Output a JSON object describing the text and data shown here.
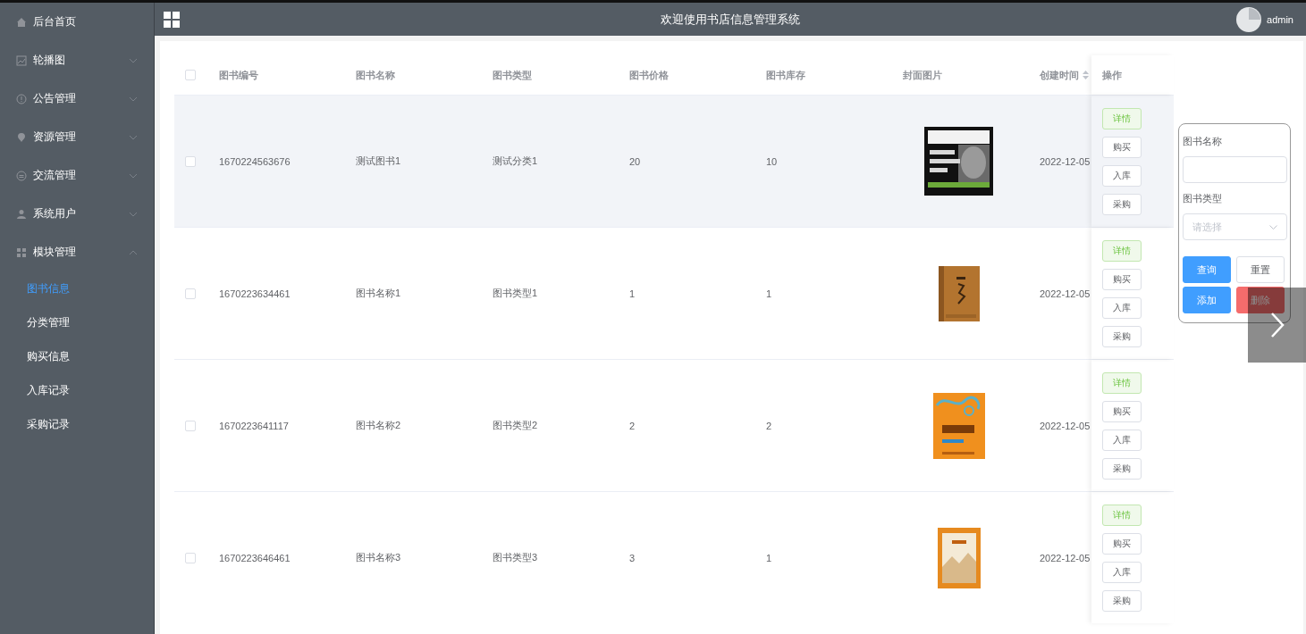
{
  "header": {
    "title": "欢迎使用书店信息管理系统",
    "user": "admin"
  },
  "sidebar": {
    "items": [
      {
        "label": "后台首页",
        "kind": "link"
      },
      {
        "label": "轮播图",
        "kind": "menu",
        "expanded": false
      },
      {
        "label": "公告管理",
        "kind": "menu",
        "expanded": false
      },
      {
        "label": "资源管理",
        "kind": "menu",
        "expanded": false
      },
      {
        "label": "交流管理",
        "kind": "menu",
        "expanded": false
      },
      {
        "label": "系统用户",
        "kind": "menu",
        "expanded": false
      },
      {
        "label": "模块管理",
        "kind": "menu",
        "expanded": true,
        "children": [
          {
            "label": "图书信息",
            "selected": true
          },
          {
            "label": "分类管理",
            "selected": false
          },
          {
            "label": "购买信息",
            "selected": false
          },
          {
            "label": "入库记录",
            "selected": false
          },
          {
            "label": "采购记录",
            "selected": false
          }
        ]
      }
    ]
  },
  "table": {
    "header_checked": false,
    "columns": [
      {
        "label": "图书编号",
        "sortable": false
      },
      {
        "label": "图书名称",
        "sortable": false
      },
      {
        "label": "图书类型",
        "sortable": false
      },
      {
        "label": "图书价格",
        "sortable": false
      },
      {
        "label": "图书库存",
        "sortable": false
      },
      {
        "label": "封面图片",
        "sortable": false
      },
      {
        "label": "创建时间",
        "sortable": true
      }
    ],
    "actions_header": "操作",
    "rows": [
      {
        "checked": false,
        "highlighted": true,
        "cells": [
          "1670224563676",
          "测试图书1",
          "测试分类1",
          "20",
          "10"
        ],
        "created": "2022-12-05",
        "actions": [
          {
            "label": "详情",
            "kind": "success"
          },
          {
            "label": "购买",
            "kind": "plain"
          },
          {
            "label": "入库",
            "kind": "plain"
          },
          {
            "label": "采购",
            "kind": "plain"
          }
        ]
      },
      {
        "checked": false,
        "highlighted": false,
        "cells": [
          "1670223634461",
          "图书名称1",
          "图书类型1",
          "1",
          "1"
        ],
        "created": "2022-12-05",
        "actions": [
          {
            "label": "详情",
            "kind": "success"
          },
          {
            "label": "购买",
            "kind": "plain"
          },
          {
            "label": "入库",
            "kind": "plain"
          },
          {
            "label": "采购",
            "kind": "plain"
          }
        ]
      },
      {
        "checked": false,
        "highlighted": false,
        "cells": [
          "1670223641117",
          "图书名称2",
          "图书类型2",
          "2",
          "2"
        ],
        "created": "2022-12-05",
        "actions": [
          {
            "label": "详情",
            "kind": "success"
          },
          {
            "label": "购买",
            "kind": "plain"
          },
          {
            "label": "入库",
            "kind": "plain"
          },
          {
            "label": "采购",
            "kind": "plain"
          }
        ]
      },
      {
        "checked": false,
        "highlighted": false,
        "cells": [
          "1670223646461",
          "图书名称3",
          "图书类型3",
          "3",
          "1"
        ],
        "created": "2022-12-05",
        "actions": [
          {
            "label": "详情",
            "kind": "success"
          },
          {
            "label": "购买",
            "kind": "plain"
          },
          {
            "label": "入库",
            "kind": "plain"
          },
          {
            "label": "采购",
            "kind": "plain"
          }
        ]
      }
    ]
  },
  "search": {
    "fields": [
      {
        "label": "图书名称",
        "kind": "text"
      },
      {
        "label": "图书类型",
        "kind": "select",
        "placeholder": "请选择"
      }
    ],
    "buttons": [
      {
        "label": "查询",
        "kind": "primary"
      },
      {
        "label": "重置",
        "kind": "plain"
      },
      {
        "label": "添加",
        "kind": "primary"
      },
      {
        "label": "删除",
        "kind": "danger"
      }
    ]
  }
}
